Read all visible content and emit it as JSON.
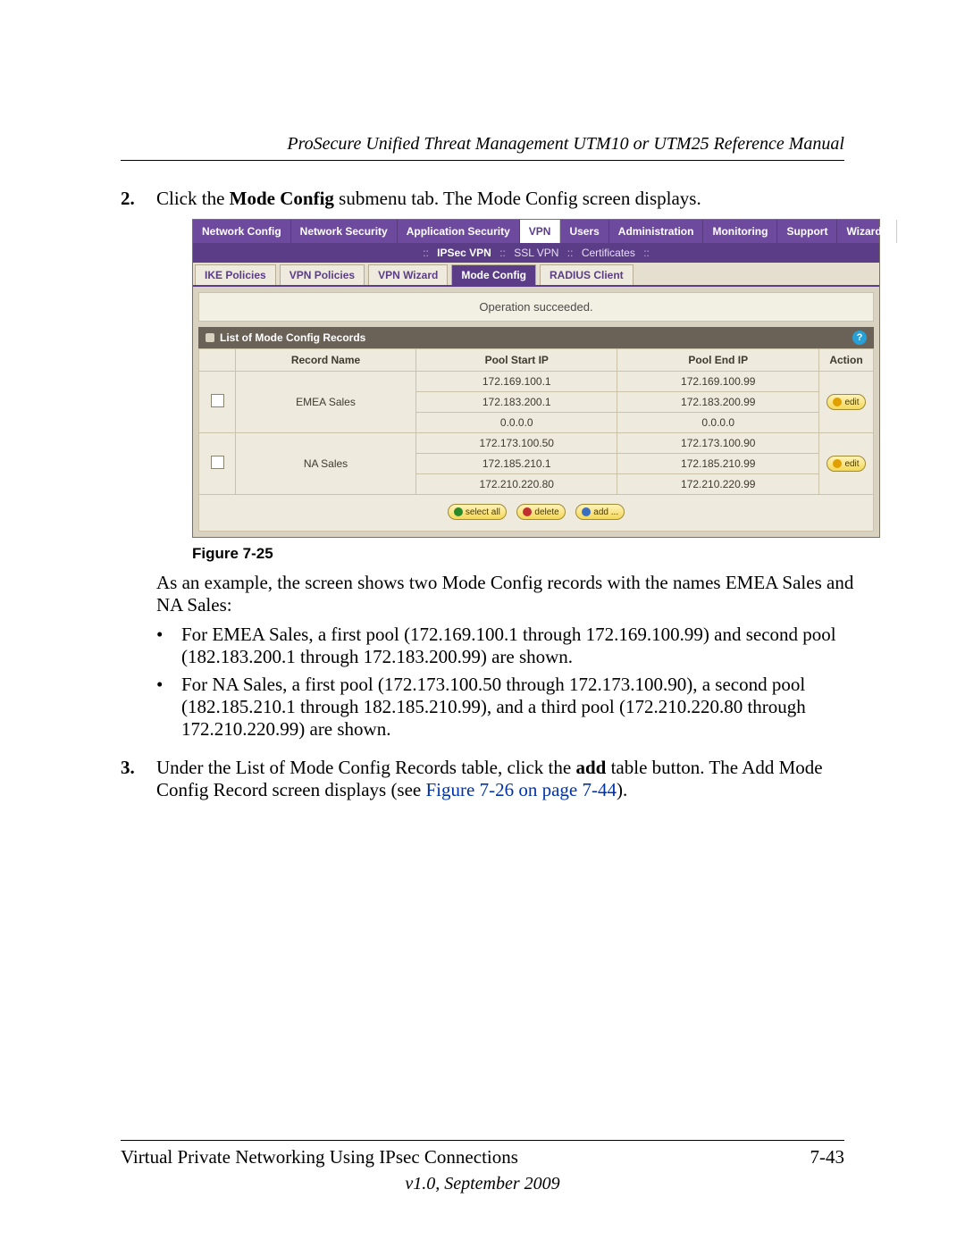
{
  "running_head": "ProSecure Unified Threat Management UTM10 or UTM25 Reference Manual",
  "steps": {
    "s2_num": "2.",
    "s2_a": "Click the ",
    "s2_b_bold": "Mode Config",
    "s2_c": " submenu tab. The Mode Config screen displays.",
    "s3_num": "3.",
    "s3_a": "Under the List of Mode Config Records table, click the ",
    "s3_b_bold": "add",
    "s3_c": " table button. The Add Mode Config Record screen displays (see ",
    "s3_link": "Figure 7-26 on page 7-44",
    "s3_d": ")."
  },
  "fig_caption": "Figure 7-25",
  "para1": "As an example, the screen shows two Mode Config records with the names EMEA Sales and NA Sales:",
  "bullets": {
    "b1": "For EMEA Sales, a first pool (172.169.100.1 through 172.169.100.99) and second pool (182.183.200.1 through 172.183.200.99) are shown.",
    "b2": "For NA Sales, a first pool (172.173.100.50 through 172.173.100.90), a second pool (182.185.210.1 through 182.185.210.99), and a third pool (172.210.220.80 through 172.210.220.99) are shown."
  },
  "footer": {
    "left": "Virtual Private Networking Using IPsec Connections",
    "right": "7-43",
    "version": "v1.0, September 2009"
  },
  "ui": {
    "main_tabs": [
      "Network Config",
      "Network Security",
      "Application Security",
      "VPN",
      "Users",
      "Administration",
      "Monitoring",
      "Support",
      "Wizards"
    ],
    "main_active": "VPN",
    "sub_tabs": [
      "IPSec VPN",
      "SSL VPN",
      "Certificates"
    ],
    "sub_active": "IPSec VPN",
    "inner_tabs": [
      "IKE Policies",
      "VPN Policies",
      "VPN Wizard",
      "Mode Config",
      "RADIUS Client"
    ],
    "inner_active": "Mode Config",
    "status": "Operation succeeded.",
    "section_title": "List of Mode Config Records",
    "columns": {
      "c0": "",
      "c1": "Record Name",
      "c2": "Pool Start IP",
      "c3": "Pool End IP",
      "c4": "Action"
    },
    "rows": [
      {
        "name": "EMEA Sales",
        "starts": [
          "172.169.100.1",
          "172.183.200.1",
          "0.0.0.0"
        ],
        "ends": [
          "172.169.100.99",
          "172.183.200.99",
          "0.0.0.0"
        ]
      },
      {
        "name": "NA Sales",
        "starts": [
          "172.173.100.50",
          "172.185.210.1",
          "172.210.220.80"
        ],
        "ends": [
          "172.173.100.90",
          "172.185.210.99",
          "172.210.220.99"
        ]
      }
    ],
    "edit_label": "edit",
    "buttons": {
      "select_all": "select all",
      "delete": "delete",
      "add": "add ..."
    },
    "help_glyph": "?"
  }
}
